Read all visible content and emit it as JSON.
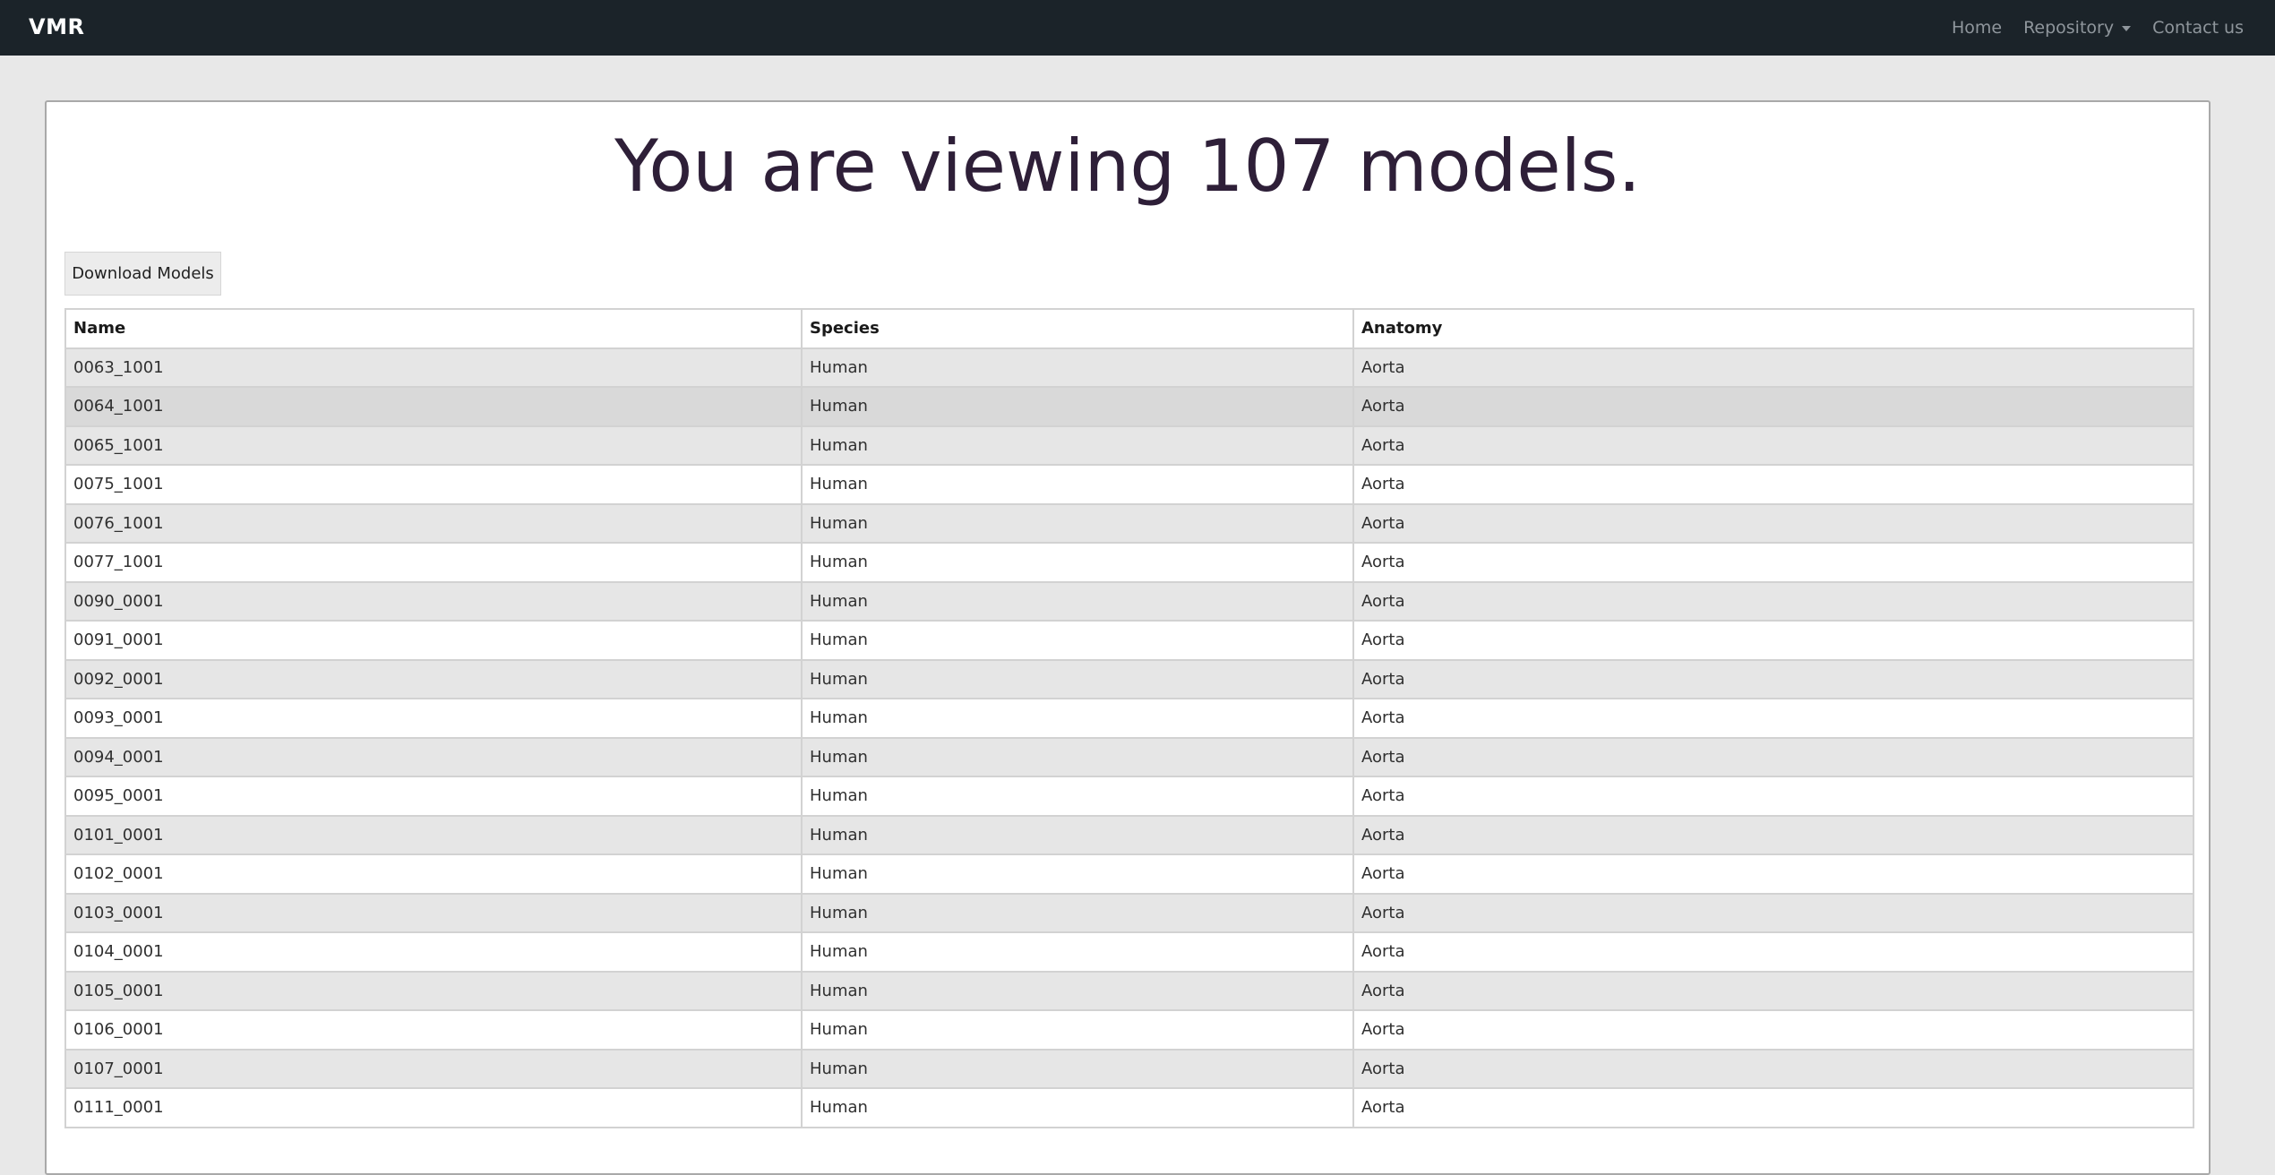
{
  "navbar": {
    "brand": "VMR",
    "links": {
      "home": "Home",
      "repository": "Repository",
      "contact": "Contact us"
    }
  },
  "main": {
    "title": "You are viewing 107 models.",
    "download_label": "Download Models"
  },
  "table": {
    "headers": [
      "Name",
      "Species",
      "Anatomy"
    ],
    "rows": [
      [
        "0063_1001",
        "Human",
        "Aorta"
      ],
      [
        "0064_1001",
        "Human",
        "Aorta"
      ],
      [
        "0065_1001",
        "Human",
        "Aorta"
      ],
      [
        "0075_1001",
        "Human",
        "Aorta"
      ],
      [
        "0076_1001",
        "Human",
        "Aorta"
      ],
      [
        "0077_1001",
        "Human",
        "Aorta"
      ],
      [
        "0090_0001",
        "Human",
        "Aorta"
      ],
      [
        "0091_0001",
        "Human",
        "Aorta"
      ],
      [
        "0092_0001",
        "Human",
        "Aorta"
      ],
      [
        "0093_0001",
        "Human",
        "Aorta"
      ],
      [
        "0094_0001",
        "Human",
        "Aorta"
      ],
      [
        "0095_0001",
        "Human",
        "Aorta"
      ],
      [
        "0101_0001",
        "Human",
        "Aorta"
      ],
      [
        "0102_0001",
        "Human",
        "Aorta"
      ],
      [
        "0103_0001",
        "Human",
        "Aorta"
      ],
      [
        "0104_0001",
        "Human",
        "Aorta"
      ],
      [
        "0105_0001",
        "Human",
        "Aorta"
      ],
      [
        "0106_0001",
        "Human",
        "Aorta"
      ],
      [
        "0107_0001",
        "Human",
        "Aorta"
      ],
      [
        "0111_0001",
        "Human",
        "Aorta"
      ]
    ]
  }
}
